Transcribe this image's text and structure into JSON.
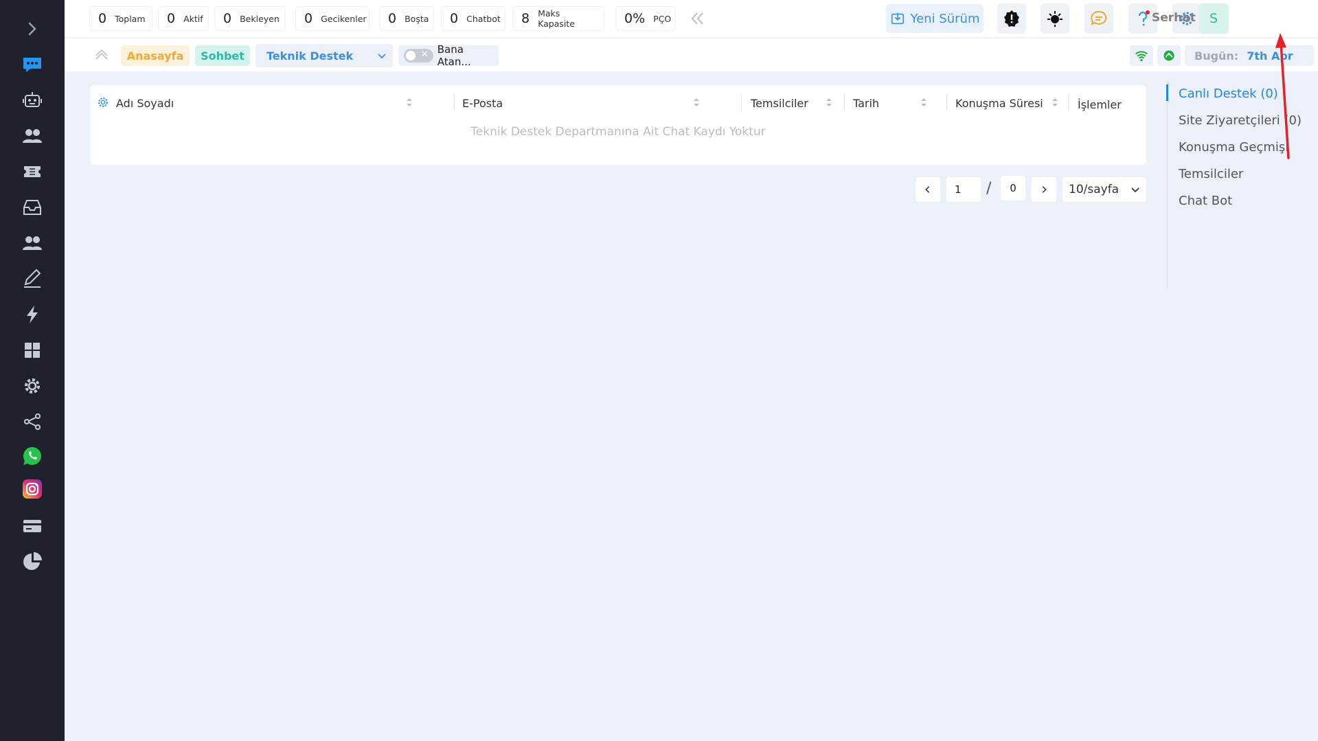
{
  "sidebar": {
    "items": [
      {
        "name": "expand-icon",
        "icon": "chevron-right"
      },
      {
        "name": "chat-bubble-icon",
        "icon": "chat"
      },
      {
        "name": "robot-icon",
        "icon": "robot"
      },
      {
        "name": "users-icon",
        "icon": "users"
      },
      {
        "name": "ticket-icon",
        "icon": "ticket"
      },
      {
        "name": "inbox-icon",
        "icon": "inbox"
      },
      {
        "name": "team-icon",
        "icon": "team"
      },
      {
        "name": "pen-icon",
        "icon": "pen"
      },
      {
        "name": "lightning-icon",
        "icon": "bolt"
      },
      {
        "name": "dashboard-icon",
        "icon": "grid"
      },
      {
        "name": "settings-icon",
        "icon": "gear"
      },
      {
        "name": "share-icon",
        "icon": "share"
      },
      {
        "name": "whatsapp-icon",
        "icon": "whatsapp"
      },
      {
        "name": "instagram-icon",
        "icon": "instagram"
      },
      {
        "name": "card-icon",
        "icon": "card"
      },
      {
        "name": "pie-chart-icon",
        "icon": "pie"
      }
    ]
  },
  "stats": [
    {
      "value": "0",
      "label": "Toplam"
    },
    {
      "value": "0",
      "label": "Aktif"
    },
    {
      "value": "0",
      "label": "Bekleyen"
    },
    {
      "value": "0",
      "label": "Gecikenler"
    },
    {
      "value": "0",
      "label": "Boşta"
    },
    {
      "value": "0",
      "label": "Chatbot"
    },
    {
      "value": "8",
      "label": "Maks Kapasite"
    },
    {
      "value": "0%",
      "label": "PÇO"
    }
  ],
  "header": {
    "new_version_label": "Yeni Sürüm",
    "user_name": "Serhat",
    "avatar_letter": "S"
  },
  "subbar": {
    "home_tag": "Anasayfa",
    "chat_tag": "Sohbet",
    "department": "Teknik Destek",
    "assigned_label": "Bana Atan...",
    "today_label": "Bugün:",
    "today_value": "7th Apr"
  },
  "table": {
    "columns": [
      "Adı Soyadı",
      "E-Posta",
      "Temsilciler",
      "Tarih",
      "Konuşma Süresi",
      "İşlemler"
    ],
    "empty_message": "Teknik Destek Departmanına Ait Chat Kaydı Yoktur"
  },
  "pagination": {
    "current_page": "1",
    "total_pages": "0",
    "page_size": "10/sayfa"
  },
  "right_nav": {
    "items": [
      "Canlı Destek (0)",
      "Site Ziyaretçileri (0)",
      "Konuşma Geçmişi",
      "Temsilciler",
      "Chat Bot"
    ]
  },
  "colors": {
    "sidebar_bg": "#1f222e",
    "accent_blue": "#1e88e5",
    "home_tag": "#f3a836",
    "chat_tag": "#2db9a4",
    "annotation_arrow": "#e8202a"
  }
}
